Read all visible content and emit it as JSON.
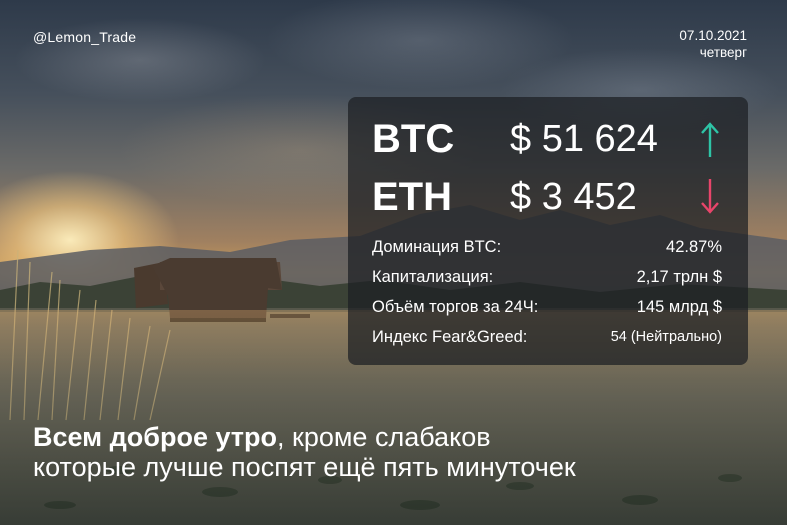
{
  "handle": "@Lemon_Trade",
  "date": "07.10.2021",
  "weekday": "четверг",
  "coins": [
    {
      "symbol": "BTC",
      "price": "$ 51 624",
      "direction": "up",
      "arrow_color": "#2ec4a6"
    },
    {
      "symbol": "ETH",
      "price": "$ 3 452",
      "direction": "down",
      "arrow_color": "#e8456a"
    }
  ],
  "stats": [
    {
      "label": "Доминация BTC:",
      "value": "42.87%"
    },
    {
      "label": "Капитализация:",
      "value": "2,17 трлн $"
    },
    {
      "label": "Объём торгов за 24Ч:",
      "value": "145 млрд $"
    },
    {
      "label": "Индекс Fear&Greed:",
      "value": "54 (Нейтрально)"
    }
  ],
  "caption": {
    "bold": "Всем доброе утро",
    "rest_line1": ", кроме слабаков",
    "line2": "которые лучше поспят ещё пять минуточек"
  }
}
